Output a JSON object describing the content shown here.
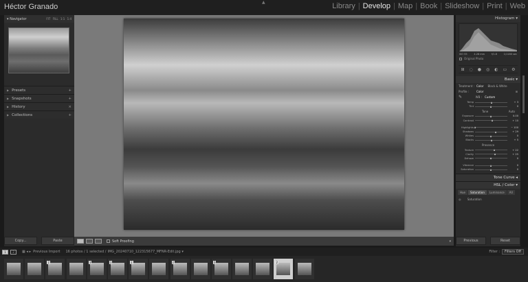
{
  "app": {
    "identity_plate": "Héctor Granado"
  },
  "modules": [
    "Library",
    "Develop",
    "Map",
    "Book",
    "Slideshow",
    "Print",
    "Web"
  ],
  "active_module": "Develop",
  "left_panel": {
    "navigator": {
      "title": "Navigator",
      "zoom_options": [
        "FIT",
        "FILL",
        "1:1",
        "1:4"
      ]
    },
    "sections": [
      {
        "label": "Presets",
        "action": "+"
      },
      {
        "label": "Snapshots",
        "action": "+"
      },
      {
        "label": "History",
        "action": "×"
      },
      {
        "label": "Collections",
        "action": "+"
      }
    ],
    "copy_label": "Copy...",
    "paste_label": "Paste"
  },
  "toolbar": {
    "soft_proofing_label": "Soft Proofing"
  },
  "right_panel": {
    "histogram_title": "Histogram",
    "histogram_info": [
      "ISO 55",
      "4.28 mm",
      "f/1.8",
      "1/1180 sec"
    ],
    "original_photo_label": "Original Photo",
    "tools": [
      "⊞",
      "◌",
      "●",
      "◎",
      "◐",
      "▭",
      "⚙"
    ],
    "basic_title": "Basic",
    "treatment": {
      "label": "Treatment :",
      "options": [
        "Color",
        "Black & White"
      ],
      "selected": "Color"
    },
    "profile": {
      "label": "Profile :",
      "value": "Color"
    },
    "wb": {
      "label": "WB :",
      "value": "Custom"
    },
    "sliders_wb": [
      {
        "name": "Temp",
        "value": "+ 3",
        "pos": 0.53
      },
      {
        "name": "Tint",
        "value": "0",
        "pos": 0.5
      }
    ],
    "tone": {
      "label": "Tone",
      "auto": "Auto"
    },
    "sliders_tone": [
      {
        "name": "Exposure",
        "value": "0.00",
        "pos": 0.5
      },
      {
        "name": "Contrast",
        "value": "+ 10",
        "pos": 0.55
      }
    ],
    "sliders_tone2": [
      {
        "name": "Highlights",
        "value": "− 100",
        "pos": 0.02
      },
      {
        "name": "Shadows",
        "value": "+ 29",
        "pos": 0.64
      },
      {
        "name": "Whites",
        "value": "0",
        "pos": 0.5
      },
      {
        "name": "Blacks",
        "value": "+ 5",
        "pos": 0.53
      }
    ],
    "presence_label": "Presence",
    "sliders_presence": [
      {
        "name": "Texture",
        "value": "+ 22",
        "pos": 0.61
      },
      {
        "name": "Clarity",
        "value": "+ 25",
        "pos": 0.62
      },
      {
        "name": "Dehaze",
        "value": "0",
        "pos": 0.5
      }
    ],
    "sliders_vibrance": [
      {
        "name": "Vibrance",
        "value": "0",
        "pos": 0.5
      },
      {
        "name": "Saturation",
        "value": "0",
        "pos": 0.5
      }
    ],
    "tone_curve_title": "Tone Curve",
    "hsl_title": "HSL / Color",
    "hsl_tabs": [
      "Hue",
      "Saturation",
      "Luminance",
      "All"
    ],
    "hsl_active": "Saturation",
    "hsl_sub": "Saturation",
    "previous_label": "Previous",
    "reset_label": "Reset"
  },
  "filmstrip": {
    "monitor1": "1",
    "monitor2": "2",
    "source": "Previous Import",
    "count": "16 photos / 1 selected /",
    "filename": "IMG_20240710_122315677_MFNR-Edit.jpg",
    "filter_label": "Filter :",
    "filter_value": "Filters Off",
    "badges": [
      "",
      "",
      "2",
      "",
      "3",
      "2",
      "2",
      "",
      "2",
      "",
      "3",
      "",
      "",
      "2",
      ""
    ],
    "active_index": 13
  }
}
